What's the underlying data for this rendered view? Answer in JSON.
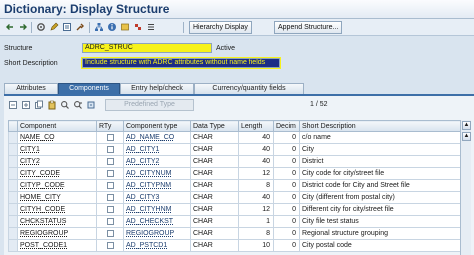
{
  "window": {
    "title": "Dictionary: Display Structure"
  },
  "toolbar": {
    "icons": [
      "back-arrow-icon",
      "forward-arrow-icon",
      "settings-icon",
      "edit-icon",
      "display-icon",
      "tools-icon",
      "hierarchy-icon",
      "info-icon",
      "object-icon",
      "hierarchy-icon-2",
      "list-icon"
    ],
    "hierarchy_display_label": "Hierarchy Display",
    "append_structure_label": "Append Structure..."
  },
  "header": {
    "structure_label": "Structure",
    "structure_value": "ADRC_STRUC",
    "status": "Active",
    "short_description_label": "Short Description",
    "short_description_value": "Include structure with ADRC attributes without name fields"
  },
  "tabs": [
    {
      "label": "Attributes",
      "active": false
    },
    {
      "label": "Components",
      "active": true
    },
    {
      "label": "Entry help/check",
      "active": false
    },
    {
      "label": "Currency/quantity fields",
      "active": false
    }
  ],
  "panel": {
    "predefined_type_label": "Predefined Type",
    "pager": "1  /  52"
  },
  "table": {
    "columns": [
      "Component",
      "RTy",
      "Component type",
      "Data Type",
      "Length",
      "Decim",
      "Short Description"
    ],
    "rows": [
      {
        "component": "NAME_CO",
        "component_type": "AD_NAME_CO",
        "data_type": "CHAR",
        "length": "40",
        "decimals": "0",
        "description": "c/o name"
      },
      {
        "component": "CITY1",
        "component_type": "AD_CITY1",
        "data_type": "CHAR",
        "length": "40",
        "decimals": "0",
        "description": "City"
      },
      {
        "component": "CITY2",
        "component_type": "AD_CITY2",
        "data_type": "CHAR",
        "length": "40",
        "decimals": "0",
        "description": "District"
      },
      {
        "component": "CITY_CODE",
        "component_type": "AD_CITYNUM",
        "data_type": "CHAR",
        "length": "12",
        "decimals": "0",
        "description": "City code for city/street file"
      },
      {
        "component": "CITYP_CODE",
        "component_type": "AD_CITYPNM",
        "data_type": "CHAR",
        "length": "8",
        "decimals": "0",
        "description": "District code for City and Street file"
      },
      {
        "component": "HOME_CITY",
        "component_type": "AD_CITY3",
        "data_type": "CHAR",
        "length": "40",
        "decimals": "0",
        "description": "City (different from postal city)"
      },
      {
        "component": "CITYH_CODE",
        "component_type": "AD_CITYHNM",
        "data_type": "CHAR",
        "length": "12",
        "decimals": "0",
        "description": "Different city for city/street file"
      },
      {
        "component": "CHCKSTATUS",
        "component_type": "AD_CHECKST",
        "data_type": "CHAR",
        "length": "1",
        "decimals": "0",
        "description": "City file test status"
      },
      {
        "component": "REGIOGROUP",
        "component_type": "REGIOGROUP",
        "data_type": "CHAR",
        "length": "8",
        "decimals": "0",
        "description": "Regional structure grouping"
      },
      {
        "component": "POST_CODE1",
        "component_type": "AD_PSTCD1",
        "data_type": "CHAR",
        "length": "10",
        "decimals": "0",
        "description": "City postal code"
      }
    ]
  }
}
